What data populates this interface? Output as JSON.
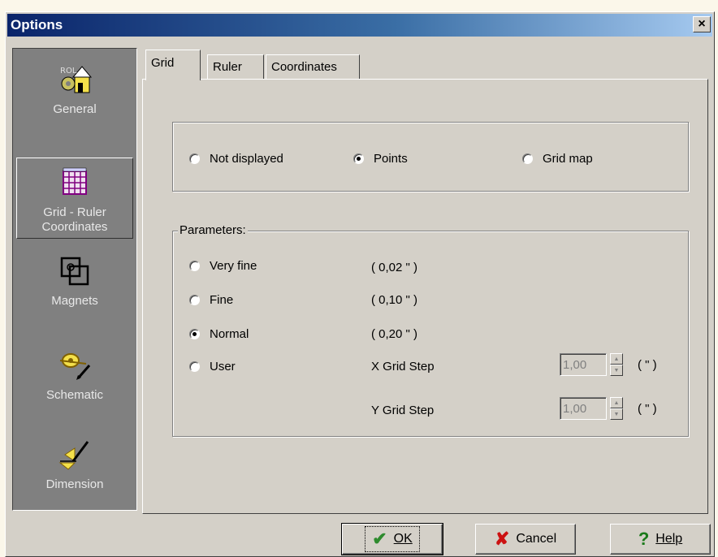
{
  "window": {
    "title": "Options",
    "close_glyph": "×"
  },
  "sidebar": {
    "items": [
      {
        "label": "General",
        "icon": "general-icon"
      },
      {
        "label": "Grid - Ruler\nCoordinates",
        "icon": "grid-icon",
        "active": true
      },
      {
        "label": "Magnets",
        "icon": "magnet-icon"
      },
      {
        "label": "Schematic",
        "icon": "schematic-icon"
      },
      {
        "label": "Dimension",
        "icon": "dimension-icon"
      }
    ]
  },
  "tabs": [
    {
      "label": "Grid",
      "active": true
    },
    {
      "label": "Ruler"
    },
    {
      "label": "Coordinates"
    }
  ],
  "display_mode": {
    "options": [
      "Not displayed",
      "Points",
      "Grid map"
    ],
    "selected": "Points"
  },
  "parameters": {
    "legend": "Parameters:",
    "options": [
      {
        "label": "Very fine",
        "value": "( 0,02 \" )"
      },
      {
        "label": "Fine",
        "value": "( 0,10 \" )"
      },
      {
        "label": "Normal",
        "value": "( 0,20 \" )"
      },
      {
        "label": "User"
      }
    ],
    "selected": "Normal",
    "x_step": {
      "label": "X Grid Step",
      "value": "1,00",
      "unit": "( \" )"
    },
    "y_step": {
      "label": "Y Grid Step",
      "value": "1,00",
      "unit": "( \" )"
    }
  },
  "buttons": {
    "ok": "OK",
    "cancel": "Cancel",
    "help": "Help"
  },
  "colors": {
    "title_start": "#0a246a",
    "title_end": "#a6caf0",
    "face": "#d4d0c8",
    "sidebar": "#808080",
    "ok_check": "#2e8b2e",
    "cancel_x": "#cc1111",
    "help_q": "#1a7a1a"
  }
}
